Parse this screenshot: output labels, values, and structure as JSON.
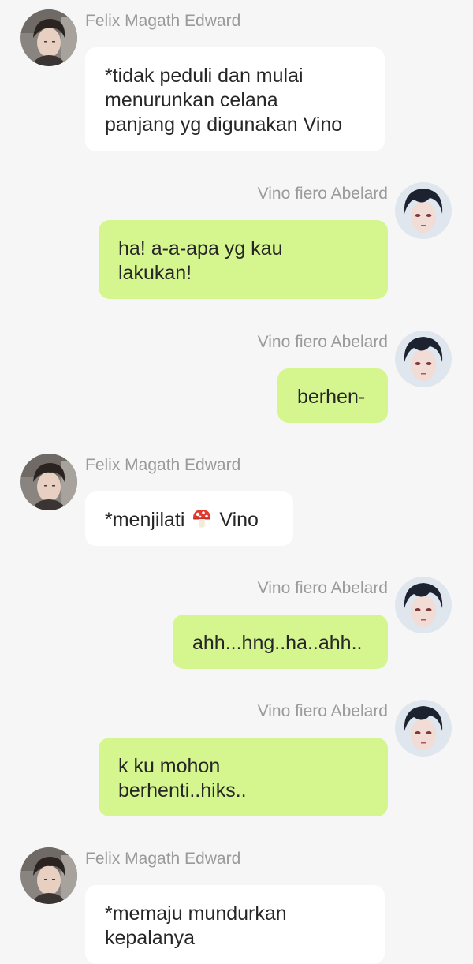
{
  "contacts": {
    "felix": {
      "name": "Felix Magath Edward",
      "avatar": "felix-avatar"
    },
    "vino": {
      "name": "Vino fiero Abelard",
      "avatar": "vino-avatar"
    }
  },
  "colors": {
    "background": "#f6f6f6",
    "incoming_bubble": "#ffffff",
    "outgoing_bubble": "#d5f58f",
    "name_text": "#9a9a9a",
    "message_text": "#262626"
  },
  "messages": [
    {
      "sender": "Felix Magath Edward",
      "side": "left",
      "text": "*tidak peduli dan mulai\nmenurunkan celana\npanjang yg digunakan Vino"
    },
    {
      "sender": "Vino fiero Abelard",
      "side": "right",
      "text": "ha! a-a-apa yg kau\nlakukan!"
    },
    {
      "sender": "Vino fiero Abelard",
      "side": "right",
      "text": "berhen-"
    },
    {
      "sender": "Felix Magath Edward",
      "side": "left",
      "text_before": "*menjilati",
      "emoji": "mushroom-icon",
      "text_after": "Vino"
    },
    {
      "sender": "Vino fiero Abelard",
      "side": "right",
      "text": "ahh...hng..ha..ahh.."
    },
    {
      "sender": "Vino fiero Abelard",
      "side": "right",
      "text": "k ku mohon\nberhenti..hiks.."
    },
    {
      "sender": "Felix Magath Edward",
      "side": "left",
      "text": "*memaju mundurkan\nkepalanya"
    }
  ]
}
